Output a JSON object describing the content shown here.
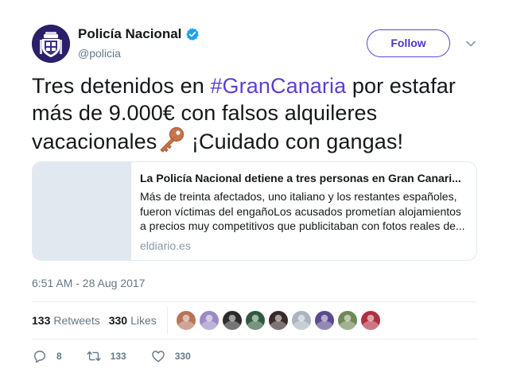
{
  "author": {
    "display_name": "Policía Nacional",
    "handle": "@policia",
    "verified": true,
    "avatar_icon": "police-badge-icon"
  },
  "follow_label": "Follow",
  "tweet": {
    "text_before": "Tres detenidos en ",
    "hashtag": "#GranCanaria",
    "text_middle": " por estafar más de 9.000€ con falsos alquileres vacacionales",
    "emoji": "key-emoji",
    "text_after": " ¡Cuidado con gangas!"
  },
  "card": {
    "title": "La Policía Nacional detiene a tres personas en Gran Canari...",
    "description": "Más de treinta afectados, uno italiano y los restantes españoles, fueron víctimas del engañoLos acusados prometían alojamientos a precios muy competitivos que publicitaban con fotos reales de...",
    "domain": "eldiario.es"
  },
  "timestamp": "6:51 AM - 28 Aug 2017",
  "stats": {
    "retweets_count": "133",
    "retweets_label": "Retweets",
    "likes_count": "330",
    "likes_label": "Likes"
  },
  "likers": [
    {
      "name": "liker-1",
      "color": "#b8745a"
    },
    {
      "name": "liker-2",
      "color": "#9a8bc2"
    },
    {
      "name": "liker-3",
      "color": "#2b2b2b"
    },
    {
      "name": "liker-4",
      "color": "#2e5a3e"
    },
    {
      "name": "liker-5",
      "color": "#3a2a2a"
    },
    {
      "name": "liker-6",
      "color": "#aab4c0"
    },
    {
      "name": "liker-7",
      "color": "#5b4a8c"
    },
    {
      "name": "liker-8",
      "color": "#6c8a54"
    },
    {
      "name": "liker-9",
      "color": "#b03040"
    }
  ],
  "actions": {
    "reply_count": "8",
    "retweet_count": "133",
    "like_count": "330"
  },
  "colors": {
    "accent": "#5b44d6",
    "hashtag": "#5b3fd6",
    "verified": "#1da1f2",
    "muted": "#657786"
  }
}
